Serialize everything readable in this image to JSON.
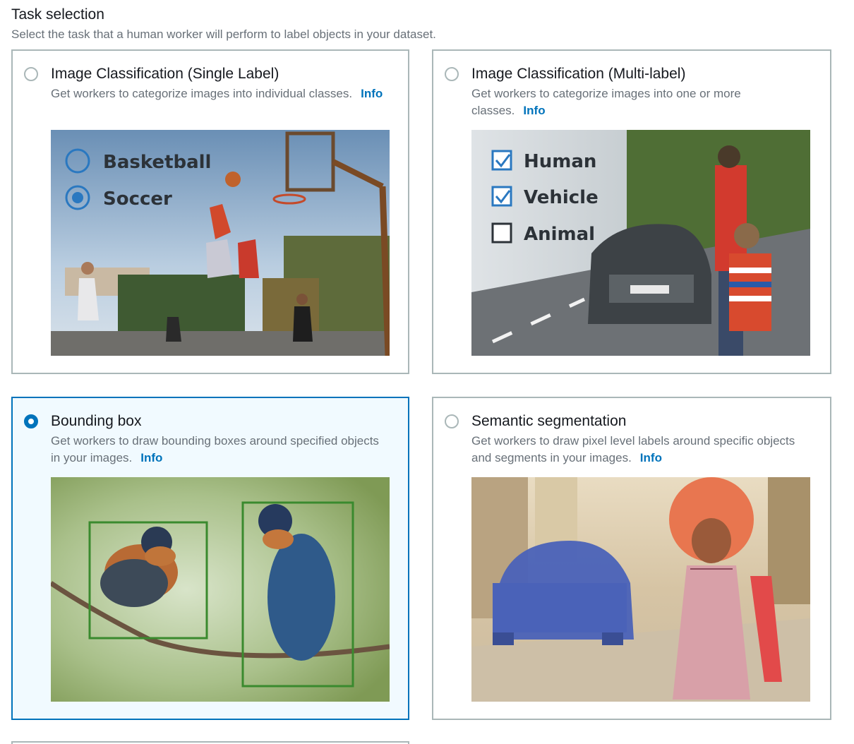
{
  "section": {
    "title": "Task selection",
    "description": "Select the task that a human worker will perform to label objects in your dataset."
  },
  "tasks": [
    {
      "title": "Image Classification (Single Label)",
      "description": "Get workers to categorize images into individual classes.",
      "info_label": "Info",
      "selected": false,
      "overlay_labels": [
        "Basketball",
        "Soccer"
      ]
    },
    {
      "title": "Image Classification (Multi-label)",
      "description": "Get workers to categorize images into one or more classes.",
      "info_label": "Info",
      "selected": false,
      "overlay_labels": [
        "Human",
        "Vehicle",
        "Animal"
      ]
    },
    {
      "title": "Bounding box",
      "description": "Get workers to draw bounding boxes around specified objects in your images.",
      "info_label": "Info",
      "selected": true
    },
    {
      "title": "Semantic segmentation",
      "description": "Get workers to draw pixel level labels around specific objects and segments in your images.",
      "info_label": "Info",
      "selected": false
    }
  ],
  "colors": {
    "accent": "#0073bb",
    "tile_border": "#aab7b8",
    "selected_background": "#f1faff",
    "bbox_stroke": "#3a8a2e",
    "segmentation_car": "#4a62b8",
    "segmentation_person": "#e8714a"
  }
}
